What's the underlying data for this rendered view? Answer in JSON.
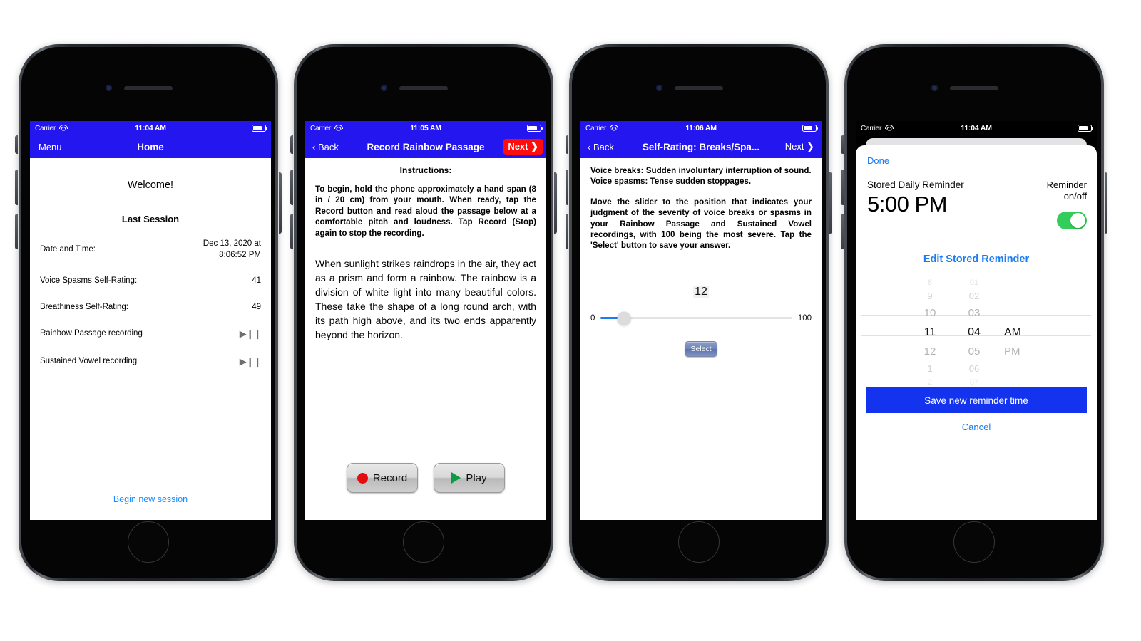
{
  "phones": [
    {
      "id": "home",
      "status_bar": {
        "carrier": "Carrier",
        "time": "11:04 AM",
        "wifi_icon": "wifi-icon",
        "battery_icon": "battery-icon"
      },
      "nav": {
        "left_label": "Menu",
        "title": "Home"
      },
      "content": {
        "welcome": "Welcome!",
        "section_title": "Last Session",
        "rows": [
          {
            "label": "Date and Time:",
            "value": "Dec 13, 2020 at\n8:06:52 PM",
            "kind": "text"
          },
          {
            "label": "Voice Spasms Self-Rating:",
            "value": "41",
            "kind": "text"
          },
          {
            "label": "Breathiness Self-Rating:",
            "value": "49",
            "kind": "text"
          },
          {
            "label": "Rainbow Passage recording",
            "value": "▶❙❙",
            "kind": "play-pause"
          },
          {
            "label": "Sustained Vowel recording",
            "value": "▶❙❙",
            "kind": "play-pause"
          }
        ],
        "begin_link": "Begin new session"
      }
    },
    {
      "id": "record",
      "status_bar": {
        "carrier": "Carrier",
        "time": "11:05 AM",
        "wifi_icon": "wifi-icon",
        "battery_icon": "battery-icon"
      },
      "nav": {
        "back_label": "‹ Back",
        "title": "Record Rainbow Passage",
        "next_label": "Next ❯"
      },
      "content": {
        "instructions_heading": "Instructions:",
        "instructions_body": "To begin, hold the phone approximately a hand span (8 in / 20 cm) from your mouth. When ready, tap the Record button and read aloud the passage below at a comfortable pitch and loudness. Tap Record (Stop) again to stop the recording.",
        "passage": "When sunlight strikes raindrops in the air, they act as a prism and form a rainbow. The rainbow is a division of white light into many beautiful colors. These take the shape of a long round arch, with its path high above, and its two ends apparently beyond the horizon.",
        "record_label": "Record",
        "play_label": "Play"
      }
    },
    {
      "id": "self-rating",
      "status_bar": {
        "carrier": "Carrier",
        "time": "11:06 AM",
        "wifi_icon": "wifi-icon",
        "battery_icon": "battery-icon"
      },
      "nav": {
        "back_label": "‹ Back",
        "title": "Self-Rating: Breaks/Spa...",
        "next_label": "Next ❯"
      },
      "content": {
        "definition_1": "Voice breaks: Sudden involuntary interruption of sound.",
        "definition_2": "Voice spasms: Tense sudden stoppages.",
        "body": "Move the slider to the position that indicates your judgment of the severity of voice breaks or spasms in your Rainbow Passage and Sustained Vowel recordings, with 100 being the most severe. Tap the 'Select' button to save your answer.",
        "slider": {
          "value": "12",
          "min_label": "0",
          "max_label": "100",
          "min": 0,
          "max": 100,
          "percent": 12
        },
        "select_label": "Select"
      }
    },
    {
      "id": "reminder",
      "status_bar": {
        "carrier": "Carrier",
        "time": "11:04 AM",
        "wifi_icon": "wifi-icon",
        "battery_icon": "battery-icon"
      },
      "content": {
        "done_label": "Done",
        "stored_label": "Stored Daily Reminder",
        "stored_time": "5:00 PM",
        "toggle_label_line1": "Reminder",
        "toggle_label_line2": "on/off",
        "toggle_state": "on",
        "edit_link": "Edit Stored Reminder",
        "picker": {
          "hours": [
            "8",
            "9",
            "10",
            "11",
            "12",
            "1",
            "2"
          ],
          "minutes": [
            "01",
            "02",
            "03",
            "04",
            "05",
            "06",
            "07"
          ],
          "meridiem": [
            "",
            "",
            "",
            "AM",
            "PM",
            "",
            ""
          ],
          "selected_hour": "11",
          "selected_minute": "04",
          "selected_meridiem": "AM"
        },
        "save_label": "Save new reminder time",
        "cancel_label": "Cancel"
      }
    }
  ],
  "colors": {
    "nav_blue": "#2316ee",
    "next_red": "#ff0d0d",
    "link_blue": "#1a7cf0",
    "save_blue": "#1433ef",
    "toggle_green": "#32cd5a",
    "slider_fill": "#1a7cf0",
    "record_dot": "#e30d11",
    "play_triangle": "#0d9a45"
  }
}
